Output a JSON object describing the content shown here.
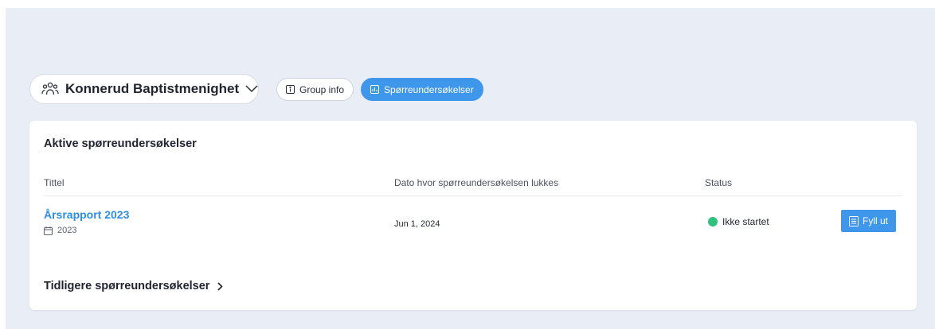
{
  "group": {
    "name": "Konnerud Baptistmenighet",
    "icon": "people-icon",
    "dropdown_icon": "chevron-down-icon"
  },
  "tabs": [
    {
      "label": "Group info",
      "icon": "info-icon",
      "active": false
    },
    {
      "label": "Spørreundersøkelser",
      "icon": "chart-icon",
      "active": true
    }
  ],
  "active_surveys": {
    "title": "Aktive spørreundersøkelser",
    "columns": [
      "Tittel",
      "Dato hvor spørreundersøkelsen lukkes",
      "Status"
    ],
    "rows": [
      {
        "title": "Årsrapport 2023",
        "year": "2023",
        "close_date": "Jun 1, 2024",
        "status": "Ikke startet",
        "status_color": "#2ec27e",
        "action_label": "Fyll ut"
      }
    ]
  },
  "previous_surveys": {
    "label": "Tidligere spørreundersøkelser",
    "icon": "chevron-right-icon"
  },
  "colors": {
    "accent": "#3f97ec",
    "link": "#2d8ce3",
    "background": "#e9edf5"
  }
}
